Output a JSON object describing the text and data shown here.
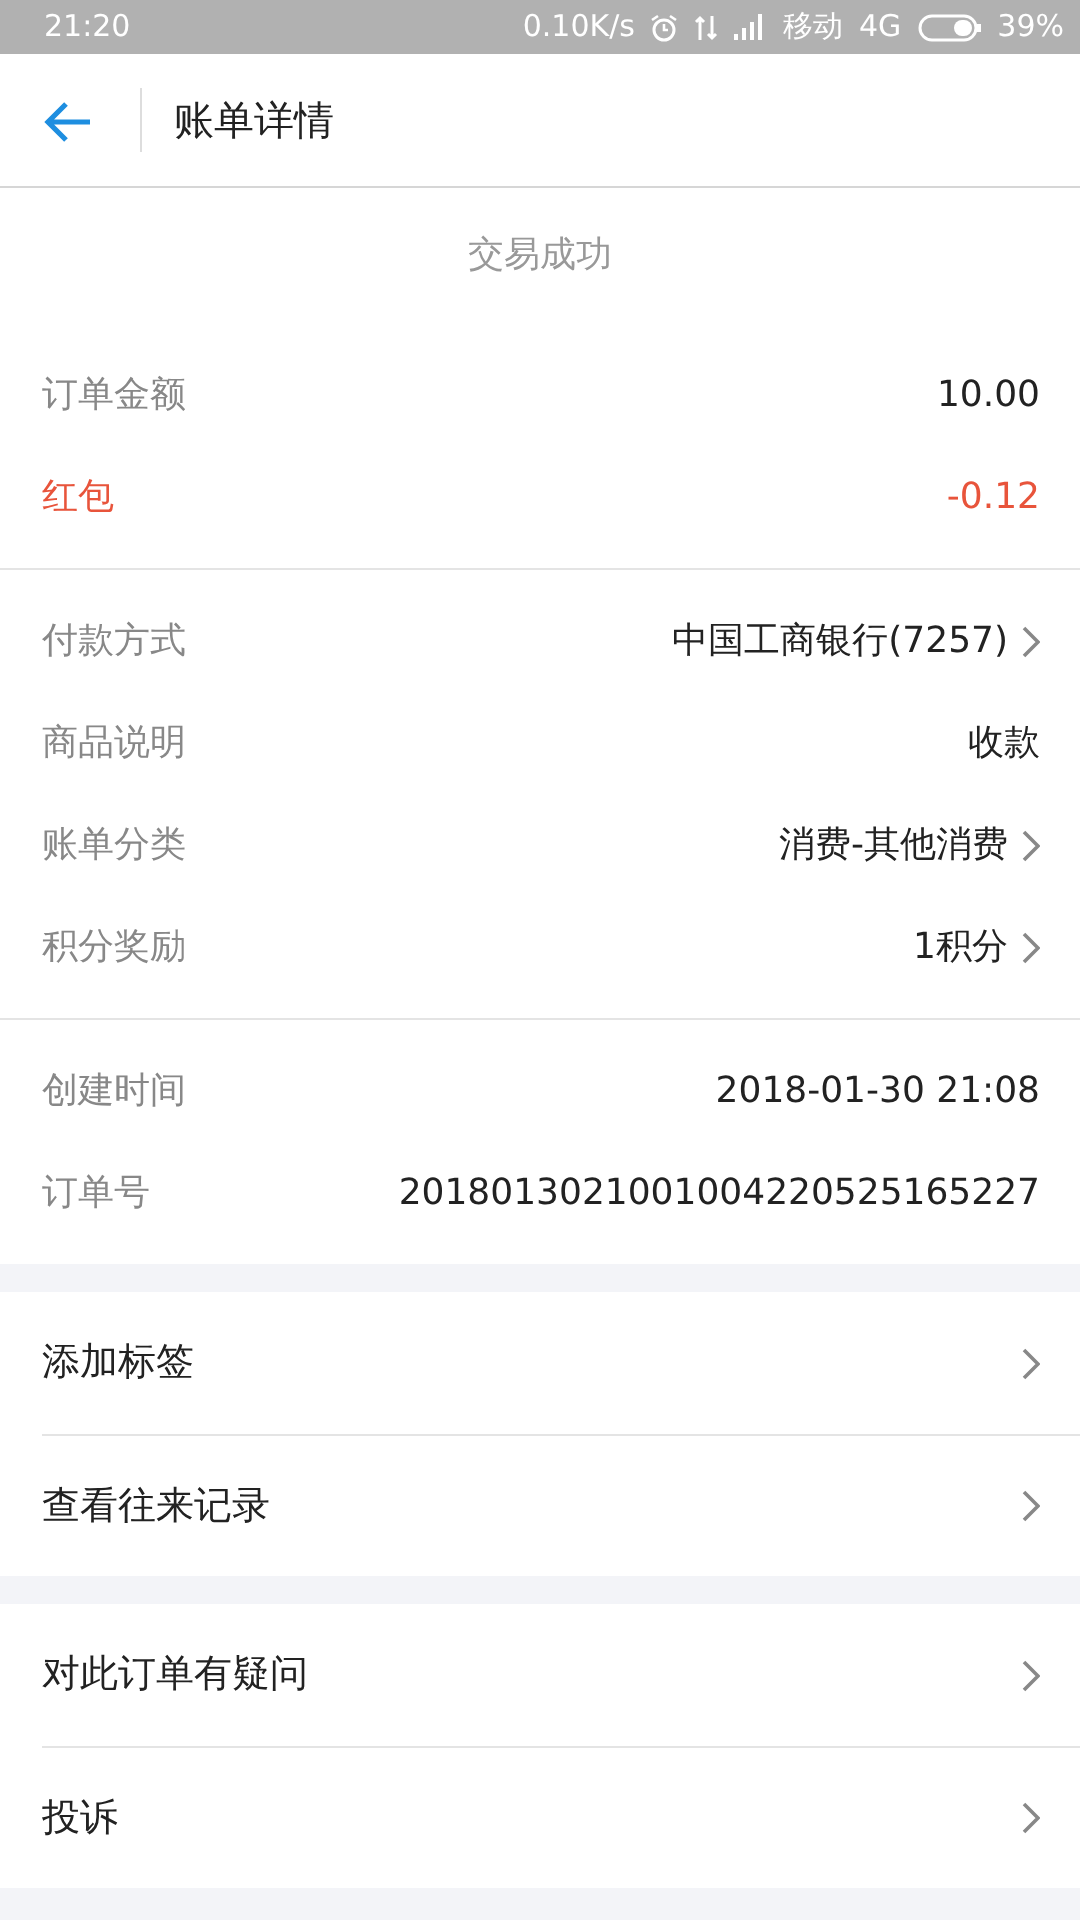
{
  "status_bar": {
    "time": "21:20",
    "net_speed": "0.10K/s",
    "carrier": "移动",
    "network": "4G",
    "battery": "39%"
  },
  "header": {
    "title": "账单详情"
  },
  "status": "交易成功",
  "detail_groups": [
    [
      {
        "label": "订单金额",
        "value": "10.00",
        "kind": "normal",
        "link": false
      },
      {
        "label": "红包",
        "value": "-0.12",
        "kind": "discount",
        "link": false
      }
    ],
    [
      {
        "label": "付款方式",
        "value": "中国工商银行(7257)",
        "kind": "normal",
        "link": true
      },
      {
        "label": "商品说明",
        "value": "收款",
        "kind": "normal",
        "link": false
      },
      {
        "label": "账单分类",
        "value": "消费-其他消费",
        "kind": "normal",
        "link": true
      },
      {
        "label": "积分奖励",
        "value": "1积分",
        "kind": "normal",
        "link": true
      }
    ],
    [
      {
        "label": "创建时间",
        "value": "2018-01-30 21:08",
        "kind": "normal",
        "link": false
      },
      {
        "label": "订单号",
        "value": "2018013021001004220525165227",
        "kind": "normal",
        "link": false
      }
    ]
  ],
  "action_groups": [
    [
      {
        "label": "添加标签"
      },
      {
        "label": "查看往来记录"
      }
    ],
    [
      {
        "label": "对此订单有疑问"
      },
      {
        "label": "投诉"
      }
    ]
  ]
}
